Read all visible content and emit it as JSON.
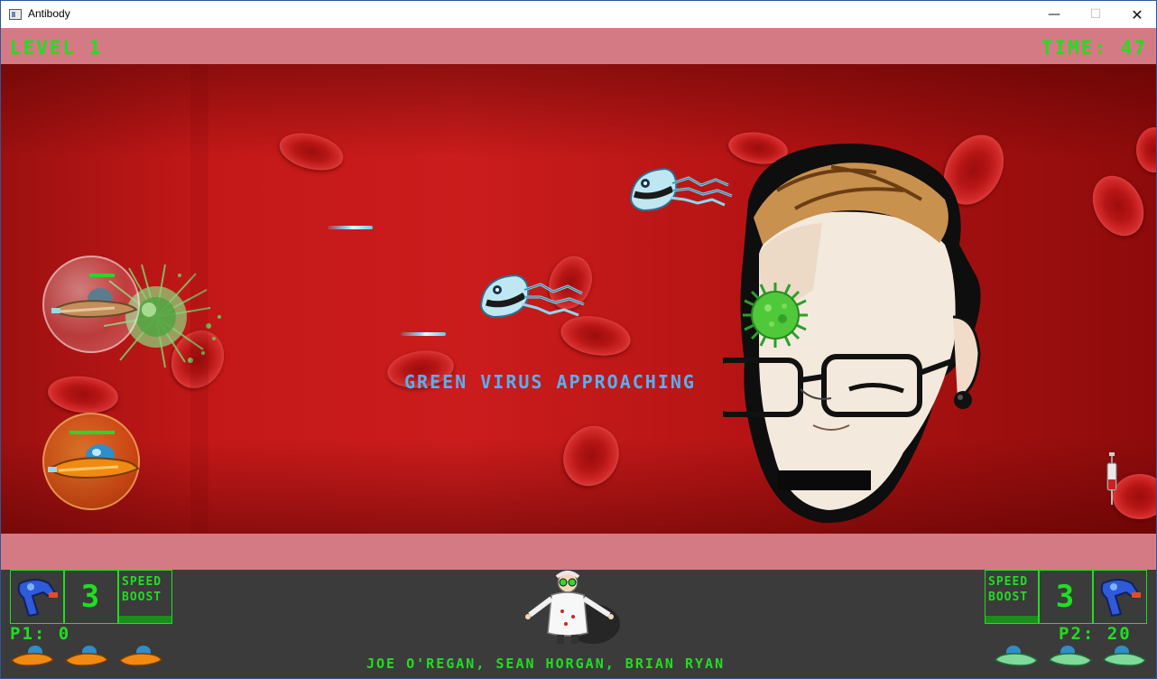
{
  "window": {
    "title": "Antibody",
    "min_glyph": "—",
    "max_glyph": "☐",
    "close_glyph": "✕"
  },
  "hud": {
    "level": "LEVEL 1",
    "time": "TIME: 47"
  },
  "message": "GREEN VIRUS APPROACHING",
  "player1": {
    "speed_boost_line1": "SPEED",
    "speed_boost_line2": "BOOST",
    "rockets": "3",
    "score": "P1: 0",
    "lives": 3
  },
  "player2": {
    "speed_boost_line1": "SPEED",
    "speed_boost_line2": "BOOST",
    "rockets": "3",
    "score": "P2: 20",
    "lives": 3
  },
  "credits": "JOE O'REGAN, SEAN HORGAN, BRIAN RYAN",
  "icons": [
    "app-window-icon",
    "blaster-gun-icon",
    "scientist-portrait",
    "ship-life-icon",
    "syringe-icon",
    "green-virus",
    "blood-cell"
  ],
  "colors": {
    "hud_text": "#22dd22",
    "message_text": "#58aff0",
    "hud_band": "#d47a84",
    "hud_panel": "#3b3b3b"
  }
}
